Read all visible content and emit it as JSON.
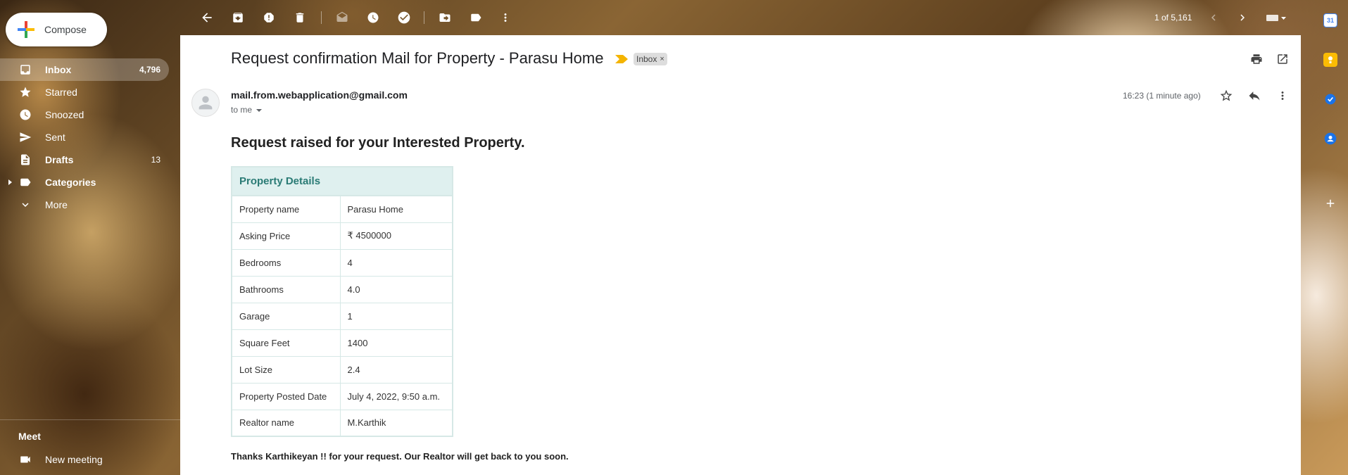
{
  "sidebar": {
    "compose_label": "Compose",
    "items": [
      {
        "label": "Inbox",
        "count": "4,796"
      },
      {
        "label": "Starred",
        "count": ""
      },
      {
        "label": "Snoozed",
        "count": ""
      },
      {
        "label": "Sent",
        "count": ""
      },
      {
        "label": "Drafts",
        "count": "13"
      },
      {
        "label": "Categories",
        "count": ""
      },
      {
        "label": "More",
        "count": ""
      }
    ],
    "meet_title": "Meet",
    "meet_new": "New meeting"
  },
  "toolbar": {
    "pager": "1 of 5,161"
  },
  "email": {
    "subject": "Request confirmation Mail for Property - Parasu Home",
    "label_chip": "Inbox",
    "chip_close": "×",
    "sender": "mail.from.webapplication@gmail.com",
    "to": "to me",
    "time": "16:23 (1 minute ago)",
    "heading": "Request raised for your Interested Property.",
    "table_title": "Property Details",
    "rows": [
      {
        "key": "Property name",
        "value": "Parasu Home"
      },
      {
        "key": "Asking Price",
        "value": "₹ 4500000"
      },
      {
        "key": "Bedrooms",
        "value": "4"
      },
      {
        "key": "Bathrooms",
        "value": "4.0"
      },
      {
        "key": "Garage",
        "value": "1"
      },
      {
        "key": "Square Feet",
        "value": "1400"
      },
      {
        "key": "Lot Size",
        "value": "2.4"
      },
      {
        "key": "Property Posted Date",
        "value": "July 4, 2022, 9:50 a.m."
      },
      {
        "key": "Realtor name",
        "value": "M.Karthik"
      }
    ],
    "footer": "Thanks Karthikeyan !! for your request. Our Realtor will get back to you soon."
  },
  "side_apps": {
    "calendar_day": "31"
  },
  "colors": {
    "table_header_bg": "#dff0ef",
    "table_header_text": "#2a7b75",
    "important_marker": "#f4b400"
  }
}
